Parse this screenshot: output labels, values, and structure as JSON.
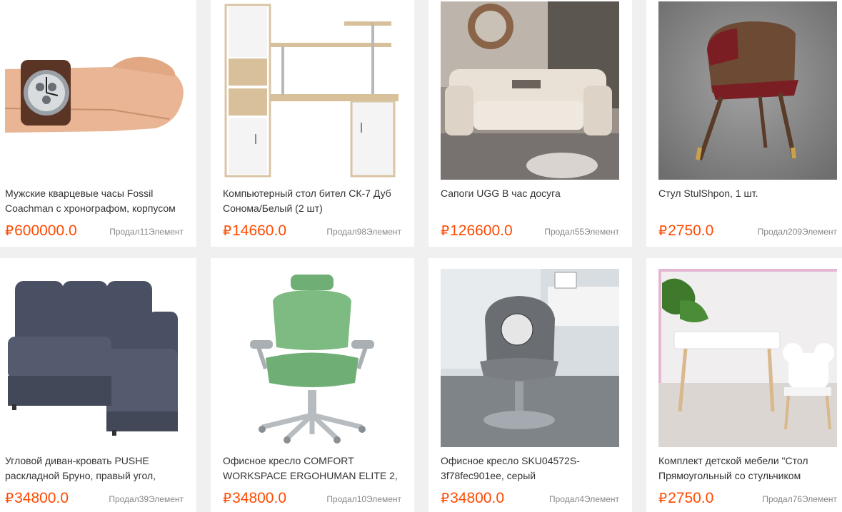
{
  "currency_symbol": "₽",
  "accent_color": "#ff4a00",
  "products": [
    {
      "name": "Мужские кварцевые часы Fossil Coachman с хронографом, корпусом",
      "price": "600000.0",
      "sold": "Продал11Элемент",
      "image_icon": "wristwatch-image"
    },
    {
      "name": "Компьютерный стол бител СК-7 Дуб Сонома/Белый  (2 шт)",
      "price": "14660.0",
      "sold": "Продал98Элемент",
      "image_icon": "computer-desk-image"
    },
    {
      "name": "Сапоги UGG В час досуга",
      "price": "126600.0",
      "sold": "Продал55Элемент",
      "image_icon": "recliner-sofa-image"
    },
    {
      "name": "Стул StulShpon, 1 шт.",
      "price": "2750.0",
      "sold": "Продал209Элемент",
      "image_icon": "dining-chair-image"
    },
    {
      "name": "Угловой диван-кровать PUSHE раскладной Бруно, правый угол,",
      "price": "34800.0",
      "sold": "Продал39Элемент",
      "image_icon": "corner-sofa-image"
    },
    {
      "name": "Офисное кресло COMFORT WORKSPACE ERGOHUMAN ELITE 2,",
      "price": "34800.0",
      "sold": "Продал10Элемент",
      "image_icon": "office-chair-image"
    },
    {
      "name": "Офисное кресло SKU04572S-3f78fec901ee, серый",
      "price": "34800.0",
      "sold": "Продал4Элемент",
      "image_icon": "swivel-chair-image"
    },
    {
      "name": "Комплект детской мебели \"Стол Прямоугольный со стульчиком",
      "price": "2750.0",
      "sold": "Продал76Элемент",
      "image_icon": "kids-furniture-image"
    }
  ]
}
